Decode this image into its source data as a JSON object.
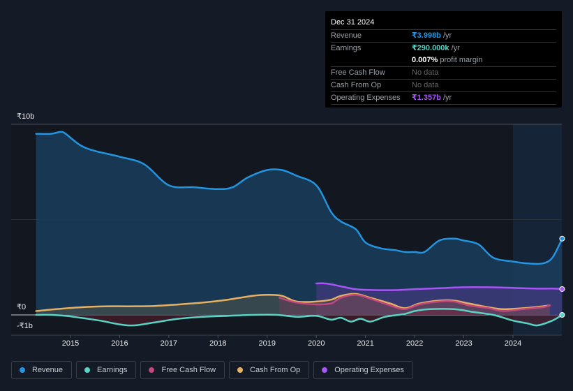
{
  "tooltip": {
    "date": "Dec 31 2024",
    "rows": [
      {
        "label": "Revenue",
        "value": "₹3.998b",
        "suffix": " /yr",
        "color": "#2394df"
      },
      {
        "label": "Earnings",
        "value": "₹290.000k",
        "suffix": " /yr",
        "color": "#58d3c4"
      },
      {
        "label": "",
        "value": "0.007%",
        "suffix": " profit margin",
        "color": "#ffffff"
      },
      {
        "label": "Free Cash Flow",
        "value": "No data",
        "suffix": "",
        "color": "#666666"
      },
      {
        "label": "Cash From Op",
        "value": "No data",
        "suffix": "",
        "color": "#666666"
      },
      {
        "label": "Operating Expenses",
        "value": "₹1.357b",
        "suffix": " /yr",
        "color": "#a855f7"
      }
    ]
  },
  "legend": [
    {
      "label": "Revenue",
      "color": "#2394df"
    },
    {
      "label": "Earnings",
      "color": "#58d3c4"
    },
    {
      "label": "Free Cash Flow",
      "color": "#c2477f"
    },
    {
      "label": "Cash From Op",
      "color": "#e8b061"
    },
    {
      "label": "Operating Expenses",
      "color": "#a855f7"
    }
  ],
  "chart_data": {
    "type": "area",
    "title": "",
    "xlabel": "",
    "ylabel": "",
    "y_unit": "₹ billions",
    "ylim": [
      -1,
      10
    ],
    "xlim": [
      2014.3,
      2025.0
    ],
    "y_tick_labels": [
      {
        "value": 10,
        "label": "₹10b"
      },
      {
        "value": 0,
        "label": "₹0"
      },
      {
        "value": -1,
        "label": "-₹1b"
      }
    ],
    "x_tick_labels": [
      "2015",
      "2016",
      "2017",
      "2018",
      "2019",
      "2020",
      "2021",
      "2022",
      "2023",
      "2024"
    ],
    "x_ticks": [
      2015,
      2016,
      2017,
      2018,
      2019,
      2020,
      2021,
      2022,
      2023,
      2024
    ],
    "highlight_range": [
      2024.0,
      2025.0
    ],
    "legend_position": "bottom-left",
    "series": [
      {
        "name": "Revenue",
        "color": "#2394df",
        "x": [
          2014.3,
          2014.6,
          2014.8,
          2014.9,
          2015.2,
          2015.5,
          2016.0,
          2016.5,
          2017.0,
          2017.5,
          2018.0,
          2018.3,
          2018.6,
          2019.0,
          2019.3,
          2019.6,
          2020.0,
          2020.3,
          2020.5,
          2020.8,
          2021.0,
          2021.3,
          2021.6,
          2021.8,
          2022.0,
          2022.2,
          2022.5,
          2022.8,
          2023.0,
          2023.3,
          2023.6,
          2024.0,
          2024.3,
          2024.6,
          2024.8,
          2025.0
        ],
        "values": [
          9.5,
          9.5,
          9.6,
          9.5,
          8.9,
          8.6,
          8.3,
          7.9,
          6.8,
          6.7,
          6.6,
          6.7,
          7.2,
          7.6,
          7.6,
          7.3,
          6.8,
          5.4,
          4.9,
          4.5,
          3.8,
          3.5,
          3.4,
          3.3,
          3.3,
          3.3,
          3.9,
          4.0,
          3.9,
          3.7,
          3.0,
          2.8,
          2.7,
          2.7,
          3.0,
          4.0
        ]
      },
      {
        "name": "Earnings",
        "color": "#58d3c4",
        "x": [
          2014.3,
          2014.6,
          2014.9,
          2015.2,
          2015.6,
          2016.0,
          2016.3,
          2016.7,
          2017.2,
          2017.7,
          2018.2,
          2018.7,
          2019.2,
          2019.6,
          2020.0,
          2020.3,
          2020.5,
          2020.7,
          2020.9,
          2021.1,
          2021.4,
          2021.8,
          2022.0,
          2022.3,
          2022.8,
          2023.2,
          2023.6,
          2024.0,
          2024.3,
          2024.5,
          2024.8,
          2025.0
        ],
        "values": [
          0.0,
          0.0,
          -0.05,
          -0.15,
          -0.3,
          -0.5,
          -0.55,
          -0.4,
          -0.2,
          -0.1,
          -0.05,
          0.0,
          0.0,
          -0.1,
          -0.05,
          -0.25,
          -0.15,
          -0.35,
          -0.2,
          -0.35,
          -0.1,
          0.05,
          0.2,
          0.3,
          0.3,
          0.15,
          0.0,
          -0.3,
          -0.45,
          -0.55,
          -0.3,
          0.0
        ]
      },
      {
        "name": "Free Cash Flow",
        "color": "#c2477f",
        "x": [
          2019.25,
          2019.6,
          2020.0,
          2020.3,
          2020.5,
          2020.8,
          2021.1,
          2021.5,
          2021.8,
          2022.1,
          2022.5,
          2022.8,
          2023.1,
          2023.5,
          2023.8,
          2024.2,
          2024.6,
          2024.75
        ],
        "values": [
          0.9,
          0.65,
          0.55,
          0.6,
          0.9,
          1.05,
          0.85,
          0.5,
          0.3,
          0.55,
          0.7,
          0.7,
          0.5,
          0.35,
          0.2,
          0.3,
          0.4,
          0.5
        ]
      },
      {
        "name": "Cash From Op",
        "color": "#e8b061",
        "x": [
          2014.3,
          2014.7,
          2015.2,
          2015.7,
          2016.2,
          2016.7,
          2017.2,
          2017.7,
          2018.2,
          2018.7,
          2019.0,
          2019.3,
          2019.6,
          2020.0,
          2020.3,
          2020.5,
          2020.8,
          2021.1,
          2021.5,
          2021.8,
          2022.1,
          2022.5,
          2022.8,
          2023.1,
          2023.5,
          2023.8,
          2024.2,
          2024.6,
          2024.75
        ],
        "values": [
          0.2,
          0.3,
          0.4,
          0.45,
          0.45,
          0.47,
          0.55,
          0.65,
          0.8,
          1.0,
          1.05,
          1.0,
          0.7,
          0.7,
          0.8,
          1.0,
          1.1,
          0.9,
          0.6,
          0.35,
          0.6,
          0.75,
          0.75,
          0.6,
          0.4,
          0.3,
          0.35,
          0.45,
          0.5
        ]
      },
      {
        "name": "Operating Expenses",
        "color": "#a855f7",
        "x": [
          2020.0,
          2020.2,
          2020.5,
          2020.8,
          2021.2,
          2021.6,
          2022.0,
          2022.5,
          2023.0,
          2023.5,
          2024.0,
          2024.4,
          2024.8,
          2025.0
        ],
        "values": [
          1.65,
          1.65,
          1.5,
          1.35,
          1.3,
          1.3,
          1.35,
          1.4,
          1.45,
          1.45,
          1.42,
          1.38,
          1.38,
          1.357
        ]
      }
    ]
  }
}
